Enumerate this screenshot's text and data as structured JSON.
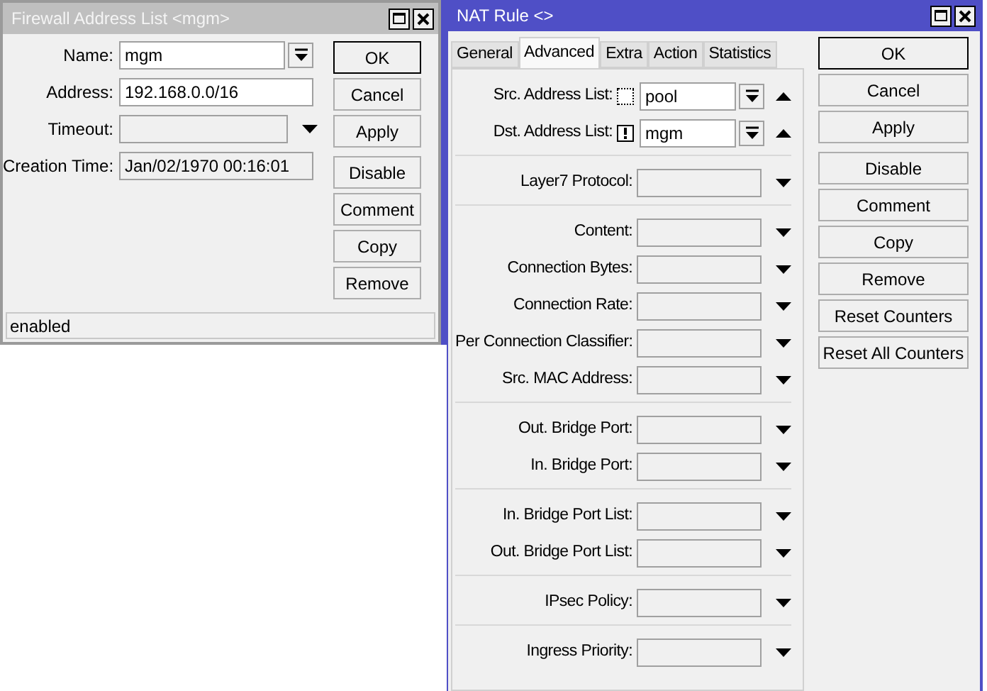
{
  "address_window": {
    "title": "Firewall Address List <mgm>",
    "active": false,
    "fields": [
      {
        "label": "Name:",
        "value": "mgm",
        "kind": "combo"
      },
      {
        "label": "Address:",
        "value": "192.168.0.0/16",
        "kind": "text"
      },
      {
        "label": "Timeout:",
        "kind": "dropdown"
      },
      {
        "label": "Creation Time:",
        "value": "Jan/02/1970 00:16:01",
        "kind": "readonly"
      }
    ],
    "button_groups": [
      [
        {
          "label": "OK",
          "default": true
        },
        {
          "label": "Cancel",
          "default": false
        },
        {
          "label": "Apply",
          "default": false
        }
      ],
      [
        {
          "label": "Disable",
          "default": false
        },
        {
          "label": "Comment",
          "default": false
        },
        {
          "label": "Copy",
          "default": false
        },
        {
          "label": "Remove",
          "default": false
        }
      ]
    ],
    "status": "enabled"
  },
  "nat_window": {
    "title": "NAT Rule <>",
    "active": true,
    "tabs": [
      {
        "label": "General",
        "selected": false
      },
      {
        "label": "Advanced",
        "selected": true
      },
      {
        "label": "Extra",
        "selected": false
      },
      {
        "label": "Action",
        "selected": false
      },
      {
        "label": "Statistics",
        "selected": false
      }
    ],
    "sections": [
      [
        {
          "label": "Src. Address List:",
          "value": "pool",
          "kind": "list",
          "negated": false
        },
        {
          "label": "Dst. Address List:",
          "value": "mgm",
          "kind": "list",
          "negated": true
        }
      ],
      [
        {
          "label": "Layer7 Protocol:",
          "kind": "dropdown"
        }
      ],
      [
        {
          "label": "Content:",
          "kind": "dropdown"
        },
        {
          "label": "Connection Bytes:",
          "kind": "dropdown"
        },
        {
          "label": "Connection Rate:",
          "kind": "dropdown"
        },
        {
          "label": "Per Connection Classifier:",
          "kind": "dropdown"
        },
        {
          "label": "Src. MAC Address:",
          "kind": "dropdown"
        }
      ],
      [
        {
          "label": "Out. Bridge Port:",
          "kind": "dropdown"
        },
        {
          "label": "In. Bridge Port:",
          "kind": "dropdown"
        }
      ],
      [
        {
          "label": "In. Bridge Port List:",
          "kind": "dropdown"
        },
        {
          "label": "Out. Bridge Port List:",
          "kind": "dropdown"
        }
      ],
      [
        {
          "label": "IPsec Policy:",
          "kind": "dropdown"
        }
      ],
      [
        {
          "label": "Ingress Priority:",
          "kind": "dropdown"
        }
      ]
    ],
    "button_groups": [
      [
        {
          "label": "OK",
          "default": true
        },
        {
          "label": "Cancel",
          "default": false
        },
        {
          "label": "Apply",
          "default": false
        }
      ],
      [
        {
          "label": "Disable",
          "default": false
        },
        {
          "label": "Comment",
          "default": false
        },
        {
          "label": "Copy",
          "default": false
        },
        {
          "label": "Remove",
          "default": false
        },
        {
          "label": "Reset Counters",
          "default": false
        },
        {
          "label": "Reset All Counters",
          "default": false
        }
      ]
    ]
  }
}
